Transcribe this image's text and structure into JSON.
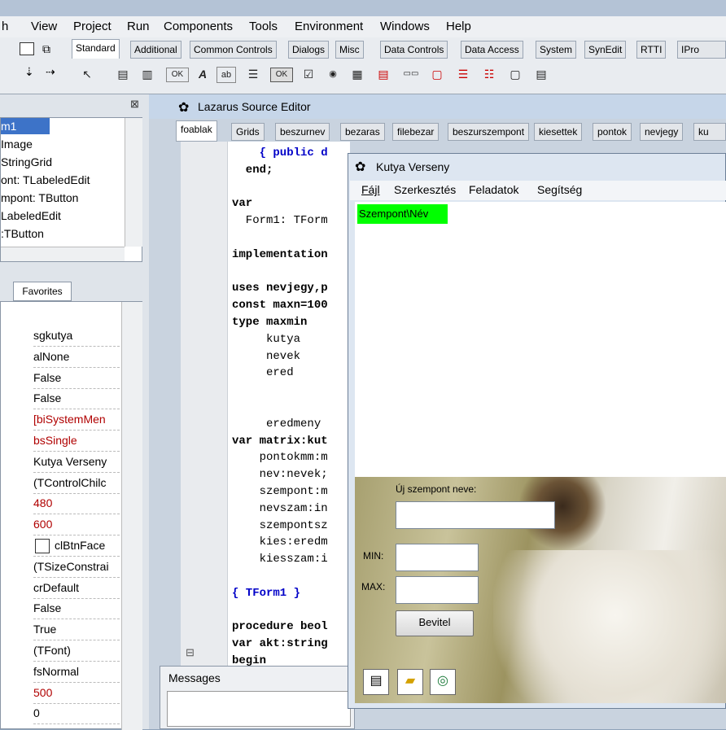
{
  "menubar": {
    "items": [
      "h",
      "View",
      "Project",
      "Run",
      "Components",
      "Tools",
      "Environment",
      "Windows",
      "Help"
    ]
  },
  "palette": {
    "tabs": [
      "Standard",
      "Additional",
      "Common Controls",
      "Dialogs",
      "Misc",
      "Data Controls",
      "Data Access",
      "System",
      "SynEdit",
      "RTTI",
      "IPro"
    ],
    "icons": [
      "pointer-icon",
      "main-menu-icon",
      "popup-menu-icon",
      "button-ok-icon",
      "label-icon",
      "edit-icon",
      "memo-icon",
      "toggle-ok-icon",
      "checkbox-icon",
      "radio-icon",
      "listbox-icon",
      "combobox-icon",
      "scrollbar-icon",
      "groupbox-icon",
      "radiogroup-icon",
      "checkgroup-icon",
      "panel-icon",
      "frame-icon",
      "actionlist-icon"
    ],
    "icon_labels": {
      "button_ok": "OK",
      "label": "A",
      "edit": "ab",
      "toggle_ok": "OK"
    }
  },
  "tree": {
    "close_glyph": "⊠",
    "items": [
      "m1",
      "Image",
      "StringGrid",
      "ont: TLabeledEdit",
      "mpont: TButton",
      "LabeledEdit",
      ":TButton",
      "LabeledEdit"
    ]
  },
  "props": {
    "tab": "Favorites",
    "values": [
      "sgkutya",
      "alNone",
      "False",
      "False",
      "[biSystemMen",
      "bsSingle",
      "Kutya Verseny",
      "(TControlChilc",
      "480",
      "600",
      "clBtnFace",
      "(TSizeConstrai",
      "crDefault",
      "False",
      "True",
      "(TFont)",
      "fsNormal",
      "500",
      "0"
    ],
    "red_indices": [
      4,
      5,
      8,
      9,
      17
    ]
  },
  "editor": {
    "title": "Lazarus Source Editor",
    "tabs": [
      "foablak",
      "Grids",
      "beszurnev",
      "bezaras",
      "filebezar",
      "beszurszempont",
      "kiesettek",
      "pontok",
      "nevjegy",
      "ku"
    ],
    "code": [
      {
        "t": "    { public d",
        "c": "cm"
      },
      {
        "t": "  end;",
        "c": "kw"
      },
      {
        "t": "",
        "c": ""
      },
      {
        "t": "var",
        "c": "kw"
      },
      {
        "t": "  Form1: TForm",
        "c": ""
      },
      {
        "t": "",
        "c": ""
      },
      {
        "t": "implementation",
        "c": "kw"
      },
      {
        "t": "",
        "c": ""
      },
      {
        "t": "uses nevjegy,p",
        "c": "kw"
      },
      {
        "t": "const maxn=100",
        "c": "kw"
      },
      {
        "t": "type maxmin",
        "c": "kw"
      },
      {
        "t": "     kutya",
        "c": ""
      },
      {
        "t": "     nevek",
        "c": ""
      },
      {
        "t": "     ered",
        "c": ""
      },
      {
        "t": "",
        "c": ""
      },
      {
        "t": "",
        "c": ""
      },
      {
        "t": "     eredmeny",
        "c": ""
      },
      {
        "t": "var matrix:kut",
        "c": "kw"
      },
      {
        "t": "    pontokmm:m",
        "c": ""
      },
      {
        "t": "    nev:nevek;",
        "c": ""
      },
      {
        "t": "    szempont:m",
        "c": ""
      },
      {
        "t": "    nevszam:in",
        "c": ""
      },
      {
        "t": "    szempontsz",
        "c": ""
      },
      {
        "t": "    kies:eredm",
        "c": ""
      },
      {
        "t": "    kiesszam:i",
        "c": ""
      },
      {
        "t": "",
        "c": ""
      },
      {
        "t": "{ TForm1 }",
        "c": "cm"
      },
      {
        "t": "",
        "c": ""
      },
      {
        "t": "procedure beol",
        "c": "kw"
      },
      {
        "t": "var akt:string",
        "c": "kw"
      },
      {
        "t": "begin",
        "c": "kw"
      }
    ],
    "fold_glyph": "⊟",
    "messages_title": "Messages"
  },
  "kutya": {
    "title": "Kutya Verseny",
    "menu": [
      "Fájl",
      "Szerkesztés",
      "Feladatok",
      "Segítség"
    ],
    "grid_header": "Szempont\\Név",
    "label_new": "Új szempont neve:",
    "label_min": "MIN:",
    "label_max": "MAX:",
    "button": "Bevitel",
    "tool_icons": [
      "note-icon",
      "folder-icon",
      "disc-icon"
    ]
  },
  "colors": {
    "grid_header": "#00ff00",
    "red_value": "#b00000",
    "keyword": "#000000",
    "comment": "#0000c8"
  }
}
